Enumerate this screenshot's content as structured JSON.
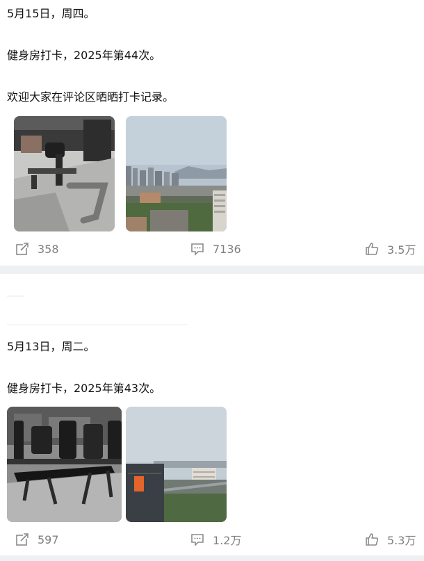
{
  "posts": [
    {
      "lines": [
        "5月15日，周四。",
        "健身房打卡，2025年第44次。",
        "欢迎大家在评论区晒晒打卡记录。"
      ],
      "images": [
        "gym-equipment-photo",
        "city-skyline-photo"
      ],
      "actions": {
        "repost_count": "358",
        "comment_count": "7136",
        "like_count": "3.5万"
      }
    },
    {
      "lines": [
        "5月13日，周二。",
        "健身房打卡，2025年第43次。"
      ],
      "images": [
        "gym-benches-photo",
        "city-buildings-photo"
      ],
      "actions": {
        "repost_count": "597",
        "comment_count": "1.2万",
        "like_count": "5.3万"
      }
    }
  ],
  "icons": {
    "repost": "repost-icon",
    "comment": "comment-icon",
    "like": "thumbs-up-icon"
  },
  "colors": {
    "action_text": "#808080",
    "separator": "#eef0f3"
  }
}
